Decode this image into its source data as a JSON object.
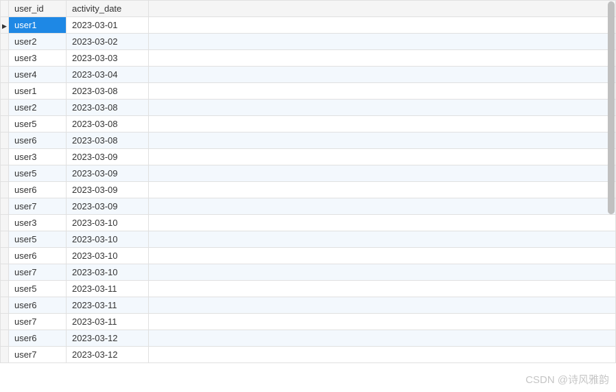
{
  "columns": {
    "user_id": "user_id",
    "activity_date": "activity_date"
  },
  "selected_row_index": 0,
  "rows": [
    {
      "user_id": "user1",
      "activity_date": "2023-03-01"
    },
    {
      "user_id": "user2",
      "activity_date": "2023-03-02"
    },
    {
      "user_id": "user3",
      "activity_date": "2023-03-03"
    },
    {
      "user_id": "user4",
      "activity_date": "2023-03-04"
    },
    {
      "user_id": "user1",
      "activity_date": "2023-03-08"
    },
    {
      "user_id": "user2",
      "activity_date": "2023-03-08"
    },
    {
      "user_id": "user5",
      "activity_date": "2023-03-08"
    },
    {
      "user_id": "user6",
      "activity_date": "2023-03-08"
    },
    {
      "user_id": "user3",
      "activity_date": "2023-03-09"
    },
    {
      "user_id": "user5",
      "activity_date": "2023-03-09"
    },
    {
      "user_id": "user6",
      "activity_date": "2023-03-09"
    },
    {
      "user_id": "user7",
      "activity_date": "2023-03-09"
    },
    {
      "user_id": "user3",
      "activity_date": "2023-03-10"
    },
    {
      "user_id": "user5",
      "activity_date": "2023-03-10"
    },
    {
      "user_id": "user6",
      "activity_date": "2023-03-10"
    },
    {
      "user_id": "user7",
      "activity_date": "2023-03-10"
    },
    {
      "user_id": "user5",
      "activity_date": "2023-03-11"
    },
    {
      "user_id": "user6",
      "activity_date": "2023-03-11"
    },
    {
      "user_id": "user7",
      "activity_date": "2023-03-11"
    },
    {
      "user_id": "user6",
      "activity_date": "2023-03-12"
    },
    {
      "user_id": "user7",
      "activity_date": "2023-03-12"
    }
  ],
  "watermark": "CSDN @诗风雅韵"
}
